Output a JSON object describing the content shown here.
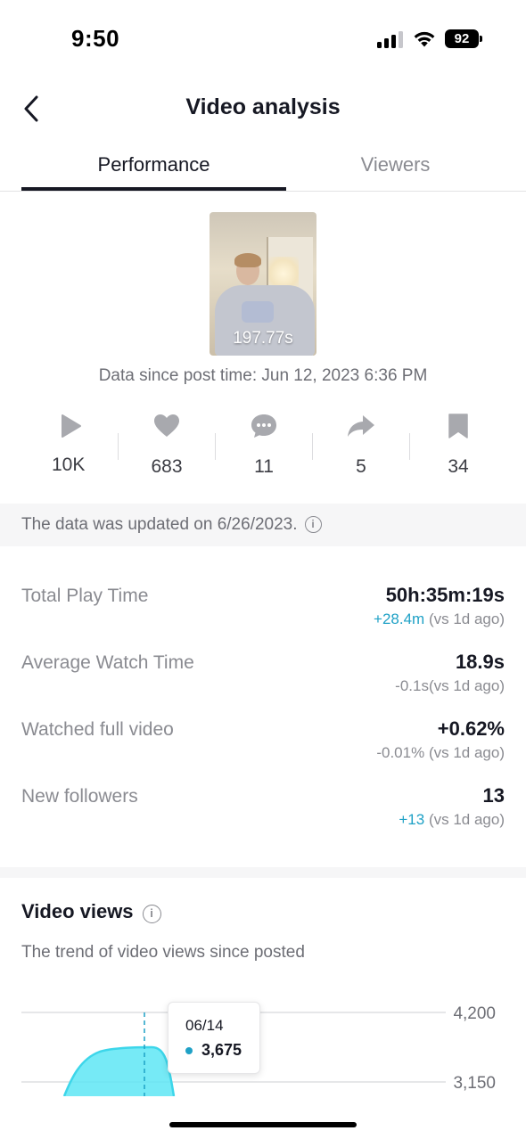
{
  "status_bar": {
    "time": "9:50",
    "battery": "92"
  },
  "header": {
    "title": "Video analysis"
  },
  "tabs": [
    {
      "label": "Performance",
      "active": true
    },
    {
      "label": "Viewers",
      "active": false
    }
  ],
  "video": {
    "duration": "197.77s",
    "post_time": "Data since post time: Jun 12, 2023 6:36 PM"
  },
  "engagement": [
    {
      "icon": "play-icon",
      "value": "10K"
    },
    {
      "icon": "heart-icon",
      "value": "683"
    },
    {
      "icon": "comment-icon",
      "value": "11"
    },
    {
      "icon": "share-icon",
      "value": "5"
    },
    {
      "icon": "bookmark-icon",
      "value": "34"
    }
  ],
  "updated_notice": "The data was updated on 6/26/2023.",
  "metrics": [
    {
      "label": "Total Play Time",
      "value": "50h:35m:19s",
      "delta": "+28.4m",
      "delta_positive": true,
      "comparison": "(vs 1d ago)"
    },
    {
      "label": "Average Watch Time",
      "value": "18.9s",
      "delta": "-0.1s",
      "delta_positive": false,
      "comparison": "(vs 1d ago)"
    },
    {
      "label": "Watched full video",
      "value": "+0.62%",
      "delta": "-0.01%",
      "delta_positive": false,
      "comparison": "(vs 1d ago)"
    },
    {
      "label": "New followers",
      "value": "13",
      "delta": "+13",
      "delta_positive": true,
      "comparison": "(vs 1d ago)"
    }
  ],
  "video_views": {
    "title": "Video views",
    "subtitle": "The trend of video views since posted",
    "tooltip": {
      "date": "06/14",
      "value": "3,675"
    }
  },
  "chart_data": {
    "type": "area",
    "title": "Video views",
    "y_ticks": [
      "4,200",
      "3,150"
    ],
    "ylim": [
      3150,
      4200
    ],
    "highlighted_point": {
      "x": "06/14",
      "y": 3675
    },
    "colors": {
      "fill": "#5ee6f5",
      "line": "#3dd6ea",
      "marker": "#1fa1c6"
    }
  },
  "colors": {
    "accent": "#1fa1c6",
    "text": "#161823",
    "muted": "#8a8b91"
  }
}
